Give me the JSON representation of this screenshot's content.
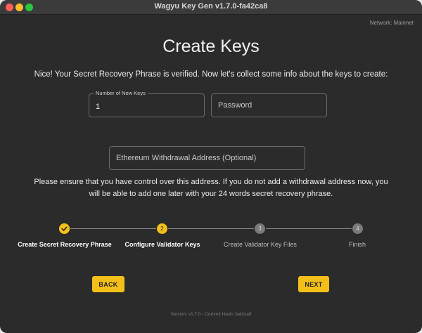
{
  "window": {
    "title": "Wagyu Key Gen v1.7.0-fa42ca8"
  },
  "network": "Network: Mainnet",
  "page": {
    "title": "Create Keys",
    "intro": "Nice! Your Secret Recovery Phrase is verified. Now let's collect some info about the keys to create:"
  },
  "form": {
    "num_keys": {
      "label": "Number of New Keys",
      "value": "1"
    },
    "password": {
      "placeholder": "Password",
      "value": ""
    },
    "withdrawal": {
      "placeholder": "Ethereum Withdrawal Address (Optional)",
      "value": ""
    }
  },
  "note": "Please ensure that you have control over this address. If you do not add a withdrawal address now, you will be able to add one later with your 24 words secret recovery phrase.",
  "stepper": {
    "steps": [
      {
        "number": "1",
        "label": "Create Secret Recovery Phrase",
        "status": "completed",
        "icon": "check-icon"
      },
      {
        "number": "2",
        "label": "Configure Validator Keys",
        "status": "active"
      },
      {
        "number": "3",
        "label": "Create Validator Key Files",
        "status": "pending"
      },
      {
        "number": "4",
        "label": "Finish",
        "status": "pending"
      }
    ]
  },
  "buttons": {
    "back": "BACK",
    "next": "NEXT"
  },
  "footer": "Version: v1.7.0 - Commit Hash: fa42ca8",
  "colors": {
    "accent": "#f3c01a",
    "background": "#2b2b2b",
    "inactive_step": "#7a7a7a"
  }
}
